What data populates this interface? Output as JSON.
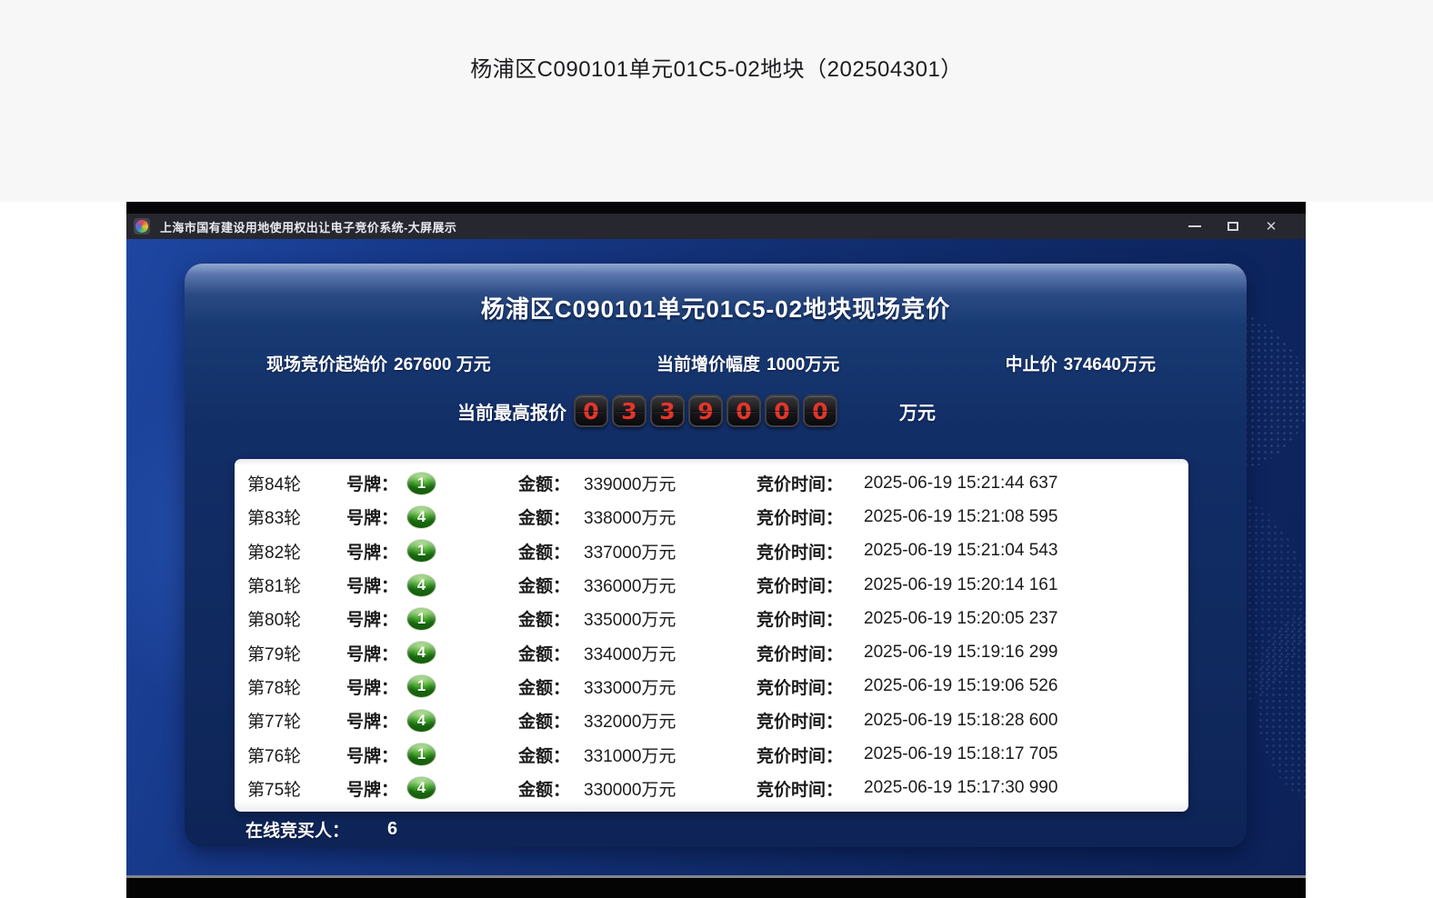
{
  "page": {
    "title": "杨浦区C090101单元01C5-02地块（202504301）"
  },
  "window": {
    "title": "上海市国有建设用地使用权出让电子竞价系统-大屏展示",
    "controls": [
      {
        "name": "minimize"
      },
      {
        "name": "maximize"
      },
      {
        "name": "close",
        "glyph": "✕"
      }
    ]
  },
  "auction": {
    "heading": "杨浦区C090101单元01C5-02地块现场竞价",
    "info": [
      {
        "label": "现场竞价起始价",
        "value": "267600 万元"
      },
      {
        "label": "当前增价幅度",
        "value": "1000万元"
      },
      {
        "label": "中止价",
        "value": "374640万元"
      }
    ],
    "highest_bid": {
      "label": "当前最高报价",
      "digits": [
        "0",
        "3",
        "3",
        "9",
        "0",
        "0",
        "0"
      ],
      "unit": "万元"
    },
    "labels": {
      "paddle": "号牌：",
      "amount": "金额：",
      "time": "竞价时间："
    },
    "bids": [
      {
        "round": "第84轮",
        "paddle": "1",
        "amount": "339000万元",
        "time": "2025-06-19 15:21:44 637"
      },
      {
        "round": "第83轮",
        "paddle": "4",
        "amount": "338000万元",
        "time": "2025-06-19 15:21:08 595"
      },
      {
        "round": "第82轮",
        "paddle": "1",
        "amount": "337000万元",
        "time": "2025-06-19 15:21:04 543"
      },
      {
        "round": "第81轮",
        "paddle": "4",
        "amount": "336000万元",
        "time": "2025-06-19 15:20:14 161"
      },
      {
        "round": "第80轮",
        "paddle": "1",
        "amount": "335000万元",
        "time": "2025-06-19 15:20:05 237"
      },
      {
        "round": "第79轮",
        "paddle": "4",
        "amount": "334000万元",
        "time": "2025-06-19 15:19:16 299"
      },
      {
        "round": "第78轮",
        "paddle": "1",
        "amount": "333000万元",
        "time": "2025-06-19 15:19:06 526"
      },
      {
        "round": "第77轮",
        "paddle": "4",
        "amount": "332000万元",
        "time": "2025-06-19 15:18:28 600"
      },
      {
        "round": "第76轮",
        "paddle": "1",
        "amount": "331000万元",
        "time": "2025-06-19 15:18:17 705"
      },
      {
        "round": "第75轮",
        "paddle": "4",
        "amount": "330000万元",
        "time": "2025-06-19 15:17:30 990"
      }
    ],
    "online_bidders": {
      "label": "在线竞买人：",
      "count": "6"
    }
  },
  "colors": {
    "digit_red": "#e5352a",
    "badge_green": "#389b23",
    "panel_navy": "#122e67",
    "background_blue": "#17398a",
    "table_white": "#ffffff",
    "titlebar_dark": "#27272f"
  }
}
